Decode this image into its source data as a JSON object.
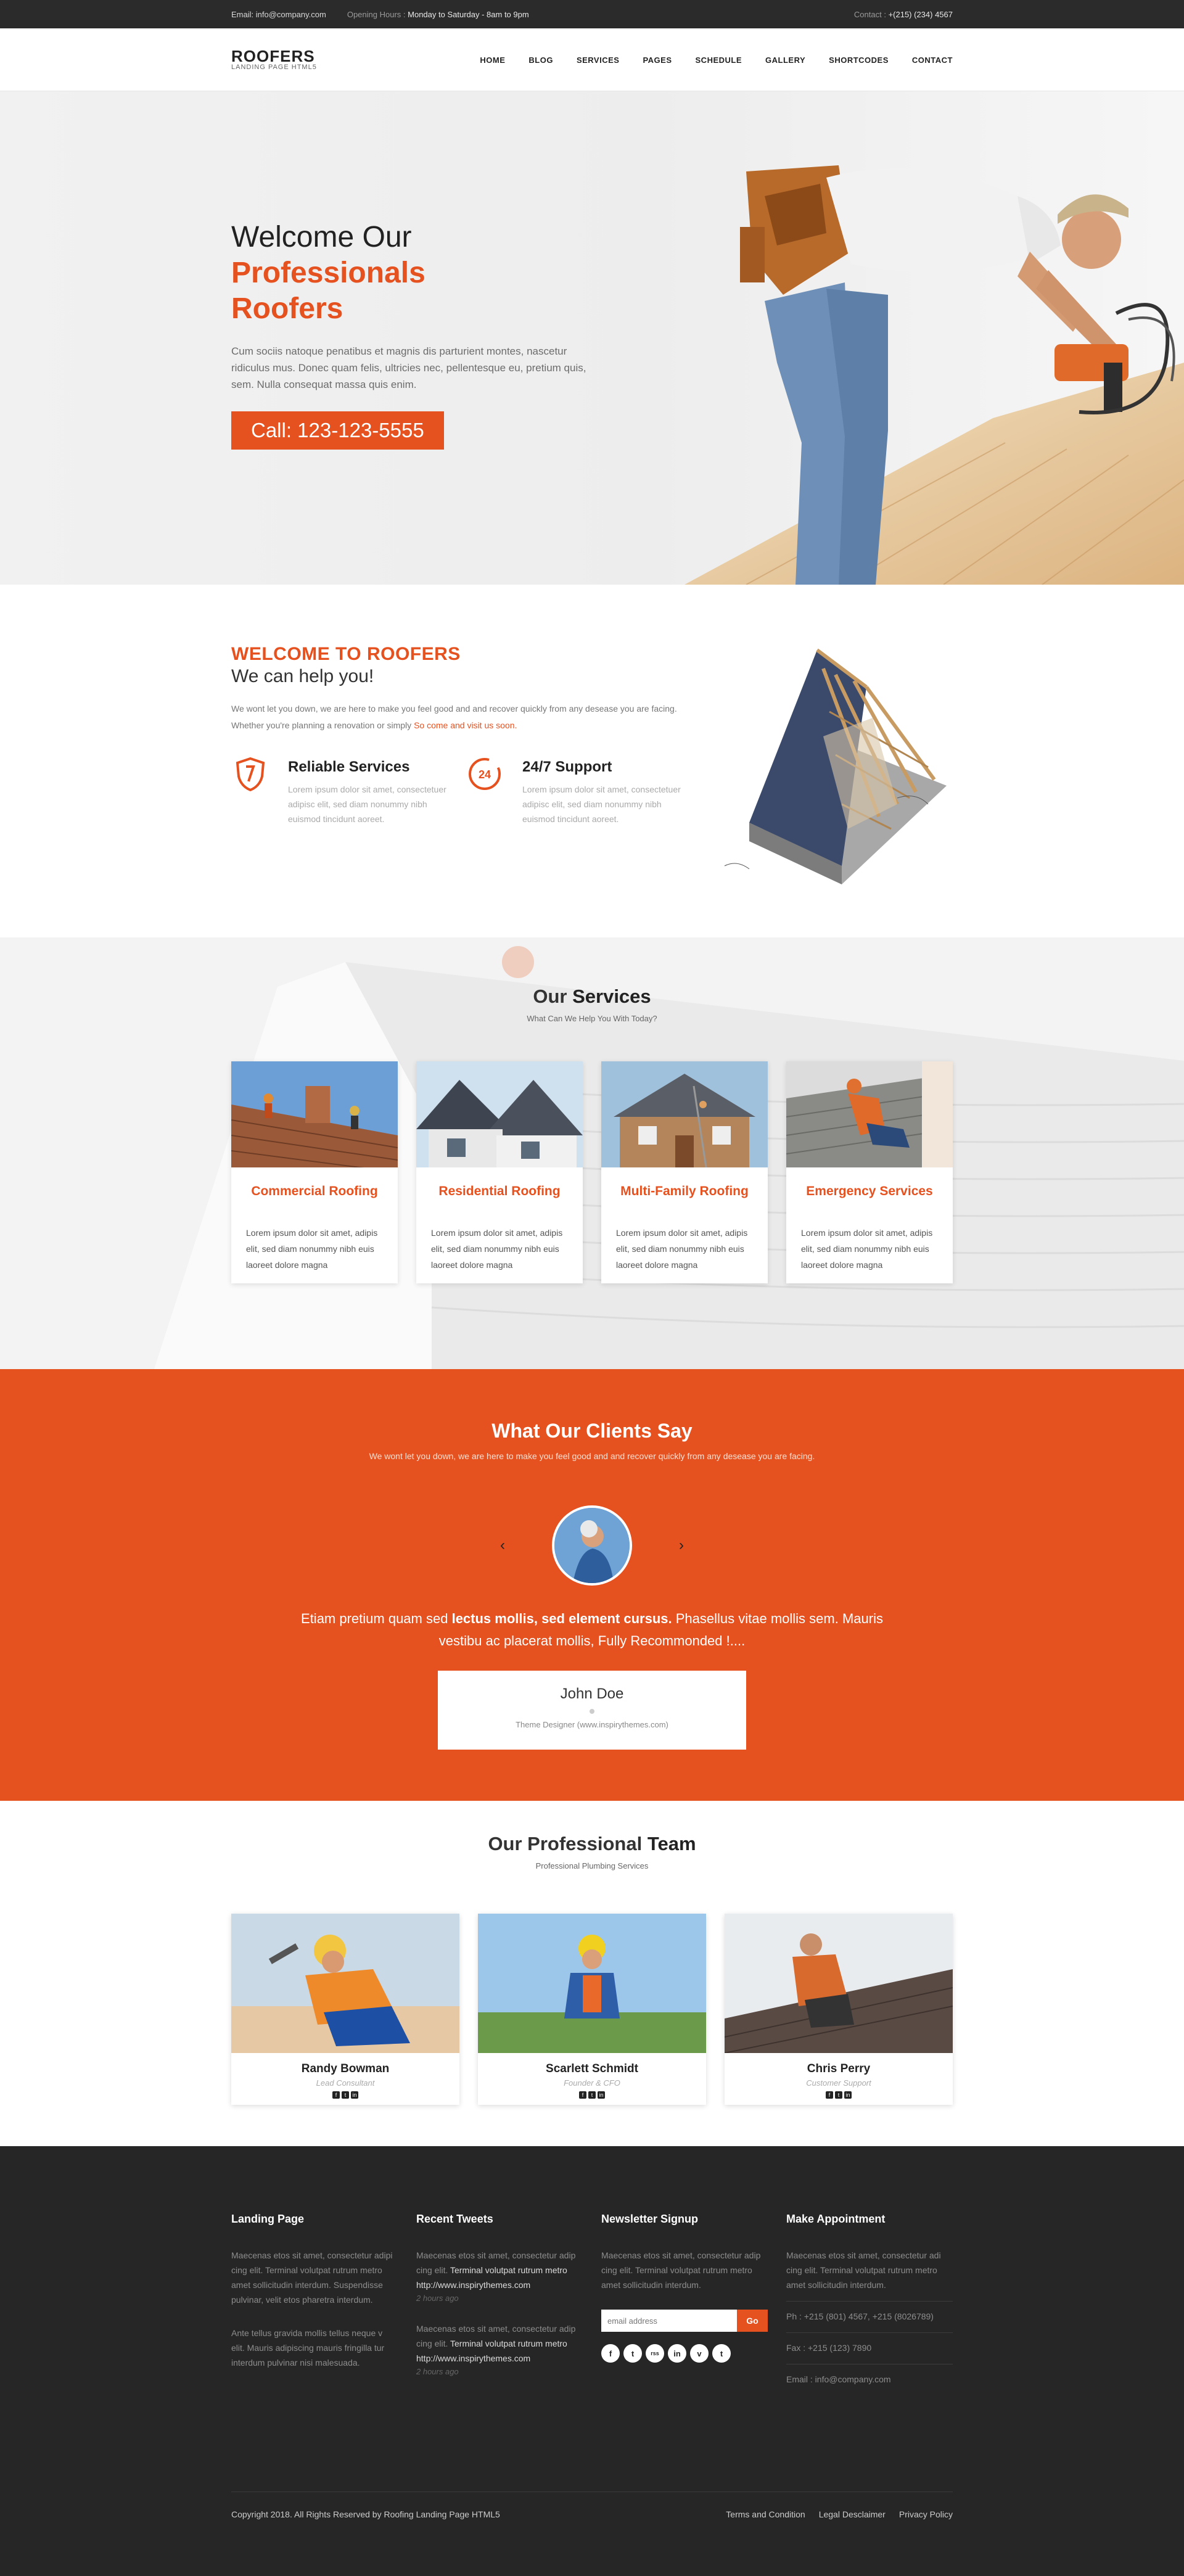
{
  "topbar": {
    "email": "Email: info@company.com",
    "hours_label": "Opening Hours :",
    "hours_value": "Monday to Saturday - 8am to 9pm",
    "contact_label": "Contact :",
    "contact_value": "+(215) (234) 4567"
  },
  "logo": {
    "name": "ROOFERS",
    "tagline": "LANDING PAGE HTML5"
  },
  "nav": [
    "HOME",
    "BLOG",
    "SERVICES",
    "PAGES",
    "SCHEDULE",
    "GALLERY",
    "SHORTCODES",
    "CONTACT"
  ],
  "hero": {
    "title_start": "Welcome Our",
    "title_highlight_1": "Professionals",
    "title_highlight_2": "Roofers",
    "description": "Cum sociis natoque penatibus et magnis dis parturient montes, nascetur ridiculus mus. Donec quam felis, ultricies nec, pellentesque eu, pretium quis, sem. Nulla consequat massa quis enim.",
    "cta": "Call: 123-123-5555"
  },
  "welcome": {
    "title": "WELCOME TO ROOFERS",
    "subtitle": "We can help you!",
    "description": "We wont let you down, we are here to make you feel good and and recover quickly from any desease you are facing. Whether you're planning a renovation or simply",
    "link": "So come and visit us soon.",
    "features": [
      {
        "icon": "shield-icon",
        "title": "Reliable Services",
        "text": "Lorem ipsum dolor sit amet, consectetuer adipisc elit, sed diam nonummy nibh euismod tincidunt aoreet."
      },
      {
        "icon": "24-hour-icon",
        "title": "24/7 Support",
        "text": "Lorem ipsum dolor sit amet, consectetuer adipisc elit, sed diam nonummy nibh euismod tincidunt aoreet."
      }
    ]
  },
  "services": {
    "title_light": "Our",
    "title_bold": "Services",
    "subtitle": "What Can We Help You With Today?",
    "items": [
      {
        "name": "Commercial Roofing",
        "text": "Lorem ipsum dolor sit amet, adipis elit, sed diam nonummy nibh euis laoreet dolore magna"
      },
      {
        "name": "Residential Roofing",
        "text": "Lorem ipsum dolor sit amet, adipis elit, sed diam nonummy nibh euis laoreet dolore magna"
      },
      {
        "name": "Multi-Family Roofing",
        "text": "Lorem ipsum dolor sit amet, adipis elit, sed diam nonummy nibh euis laoreet dolore magna"
      },
      {
        "name": "Emergency Services",
        "text": "Lorem ipsum dolor sit amet, adipis elit, sed diam nonummy nibh euis laoreet dolore magna"
      }
    ]
  },
  "testimonials": {
    "title_light": "What Our",
    "title_bold": "Clients Say",
    "subtitle": "We wont let you down, we are here to make you feel good and and recover quickly from any desease you are facing.",
    "quote_start": "Etiam pretium quam sed",
    "quote_bold": "lectus mollis, sed element cursus.",
    "quote_end": "Phasellus vitae mollis sem. Mauris vestibu ac placerat mollis, Fully Recommonded !....",
    "name": "John Doe",
    "role": "Theme Designer (www.inspirythemes.com)",
    "prev": "‹",
    "next": "›"
  },
  "team": {
    "title_light": "Our Professional",
    "title_bold": "Team",
    "subtitle": "Professional Plumbing Services",
    "members": [
      {
        "name": "Randy Bowman",
        "role": "Lead Consultant"
      },
      {
        "name": "Scarlett Schmidt",
        "role": "Founder & CFO"
      },
      {
        "name": "Chris Perry",
        "role": "Customer Support"
      }
    ]
  },
  "footer": {
    "col1": {
      "heading": "Landing Page",
      "p1": "Maecenas etos sit amet, consectetur adipi cing elit. Terminal volutpat rutrum metro amet sollicitudin interdum. Suspendisse pulvinar, velit etos pharetra interdum.",
      "p2": "Ante tellus gravida mollis tellus neque v elit. Mauris adipiscing mauris fringilla tur interdum pulvinar nisi malesuada."
    },
    "col2": {
      "heading": "Recent Tweets",
      "tweets": [
        {
          "text": "Maecenas etos sit amet, consectetur adip cing elit.",
          "bold": "Terminal volutpat rutrum metro http://www.inspirythemes.com",
          "time": "2 hours ago"
        },
        {
          "text": "Maecenas etos sit amet, consectetur adip cing elit.",
          "bold": "Terminal volutpat rutrum metro http://www.inspirythemes.com",
          "time": "2 hours ago"
        }
      ]
    },
    "col3": {
      "heading": "Newsletter Signup",
      "text": "Maecenas etos sit amet, consectetur adip cing elit. Terminal volutpat rutrum metro amet sollicitudin interdum.",
      "placeholder": "email address",
      "button": "Go",
      "social": [
        "f",
        "t",
        "rss",
        "in",
        "v",
        "t"
      ]
    },
    "col4": {
      "heading": "Make Appointment",
      "text": "Maecenas etos sit amet, consectetur adi cing elit. Terminal volutpat rutrum metro amet sollicitudin interdum.",
      "phone": "Ph : +215 (801) 4567, +215 (8026789)",
      "fax": "Fax : +215 (123) 7890",
      "email": "Email : info@company.com"
    },
    "copyright": "Copyright 2018. All Rights Reserved by Roofing Landing Page HTML5",
    "links": [
      "Terms and Condition",
      "Legal Desclaimer",
      "Privacy Policy"
    ]
  },
  "colors": {
    "accent": "#e5511f",
    "dark": "#262626",
    "topbar": "#2b2b2b"
  }
}
